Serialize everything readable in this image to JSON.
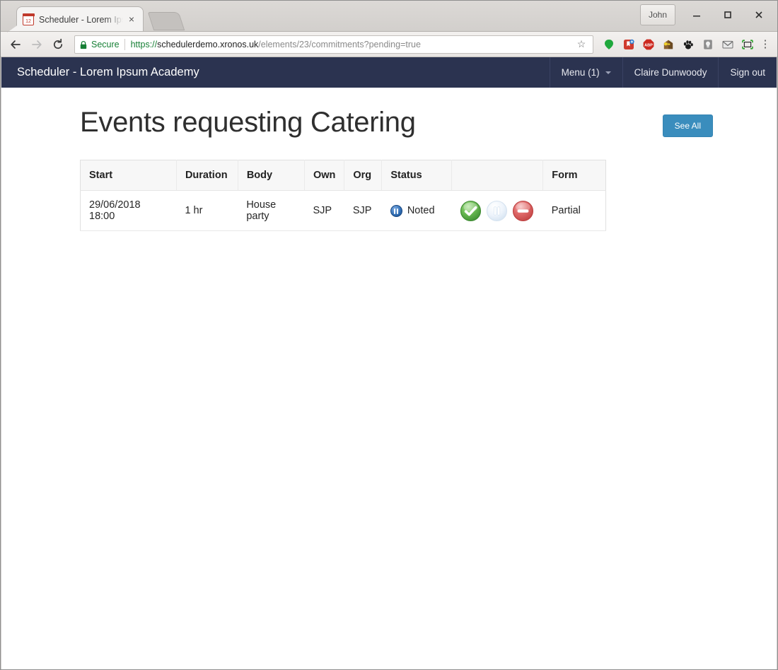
{
  "browser": {
    "tab": {
      "title": "Scheduler - Lorem Ipsum Academy",
      "favicon": "calendar-icon",
      "close": "×"
    },
    "window_controls": {
      "profile_label": "John",
      "minimize": "minimize-icon",
      "maximize": "maximize-icon",
      "close": "close-icon"
    },
    "toolbar": {
      "back": "back-arrow-icon",
      "forward": "forward-arrow-icon",
      "reload": "reload-icon",
      "security_label": "Secure",
      "url_scheme": "https://",
      "url_host": "schedulerdemo.xronos.uk",
      "url_path": "/elements/23/commitments?pending=true",
      "bookmark": "☆",
      "extensions": [
        "green-balloon-icon",
        "red-bookmark-icon",
        "adblock-plus-icon",
        "key-house-icon",
        "paw-icon",
        "lightbulb-icon",
        "mail-icon",
        "screenshot-frame-icon"
      ],
      "menu": "chrome-menu-icon"
    }
  },
  "app": {
    "navbar": {
      "brand": "Scheduler - Lorem Ipsum Academy",
      "menu_label": "Menu (1)",
      "user_name": "Claire Dunwoody",
      "sign_out_label": "Sign out",
      "background_color": "#2b3350"
    },
    "page": {
      "title": "Events requesting Catering",
      "see_all_label": "See All",
      "see_all_color": "#3a8dbd"
    },
    "table": {
      "columns": [
        "Start",
        "Duration",
        "Body",
        "Own",
        "Org",
        "Status",
        "",
        "Form"
      ],
      "rows": [
        {
          "start": "29/06/2018 18:00",
          "duration": "1 hr",
          "body": "House party",
          "own": "SJP",
          "org": "SJP",
          "status_text": "Noted",
          "status_icon": "pause-circle-blue-icon",
          "actions": [
            {
              "name": "approve-button",
              "icon": "green-check-circle-icon",
              "color": "#54a24b",
              "state": "enabled"
            },
            {
              "name": "hold-button",
              "icon": "pause-circle-icon",
              "color": "#dfe9f3",
              "state": "disabled"
            },
            {
              "name": "reject-button",
              "icon": "red-minus-circle-icon",
              "color": "#d95c5c",
              "state": "enabled"
            }
          ],
          "form": "Partial"
        }
      ]
    }
  }
}
